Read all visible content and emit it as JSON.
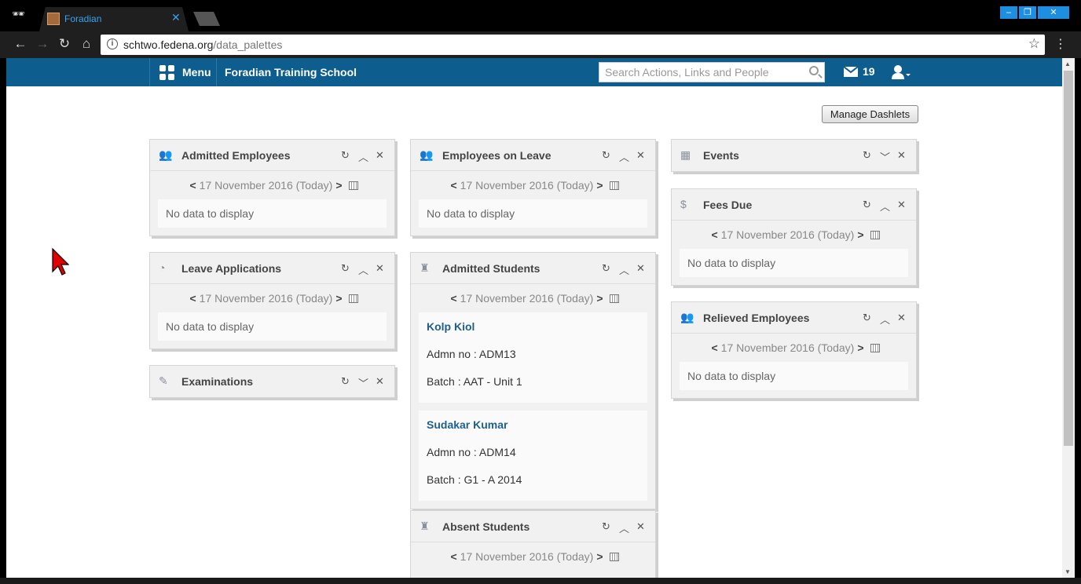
{
  "browser": {
    "tab_title": "Foradian",
    "url_host": "schtwo.fedena.org",
    "url_path": "/data_palettes"
  },
  "app": {
    "menu_label": "Menu",
    "school_name": "Foradian Training School",
    "search_placeholder": "Search Actions, Links and People",
    "mail_count": "19",
    "manage_button": "Manage Dashlets",
    "brand_color": "#0d5e8f"
  },
  "common": {
    "date": "17 November 2016 (Today)",
    "empty": "No data to display"
  },
  "dashlets": {
    "admitted_employees": {
      "title": "Admitted Employees"
    },
    "employees_on_leave": {
      "title": "Employees on Leave"
    },
    "events": {
      "title": "Events"
    },
    "fees_due": {
      "title": "Fees Due"
    },
    "leave_applications": {
      "title": "Leave Applications"
    },
    "admitted_students": {
      "title": "Admitted Students",
      "students": [
        {
          "name": "Kolp Kiol",
          "admn": "Admn no : ADM13",
          "batch": "Batch : AAT - Unit 1"
        },
        {
          "name": "Sudakar Kumar",
          "admn": "Admn no : ADM14",
          "batch": "Batch : G1 - A 2014"
        }
      ]
    },
    "relieved_employees": {
      "title": "Relieved Employees"
    },
    "examinations": {
      "title": "Examinations"
    },
    "absent_students": {
      "title": "Absent Students"
    }
  }
}
